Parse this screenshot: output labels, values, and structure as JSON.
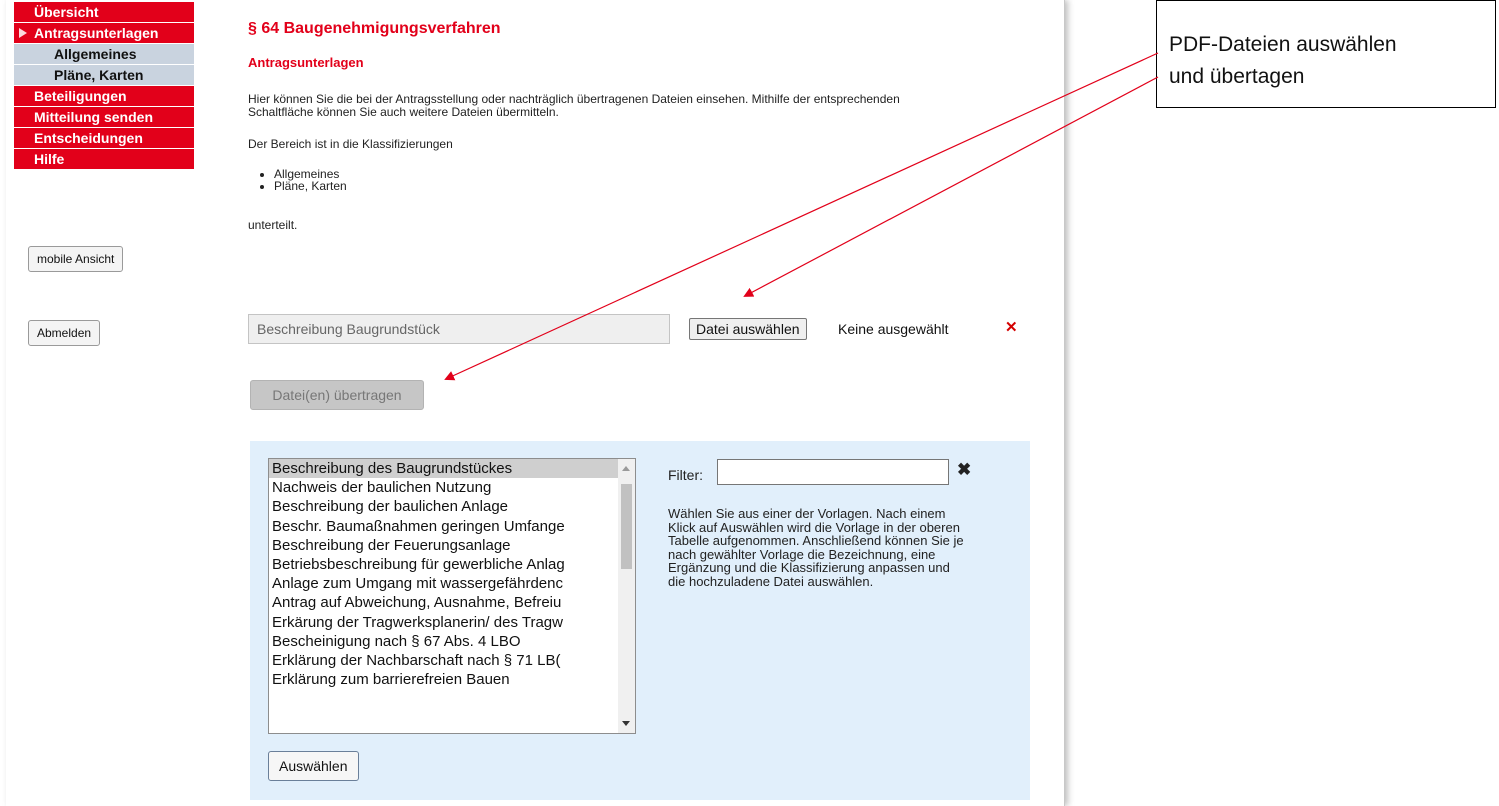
{
  "sidebar": {
    "items": [
      {
        "label": "Übersicht"
      },
      {
        "label": "Antragsunterlagen"
      },
      {
        "label": "Allgemeines"
      },
      {
        "label": "Pläne, Karten"
      },
      {
        "label": "Beteiligungen"
      },
      {
        "label": "Mitteilung senden"
      },
      {
        "label": "Entscheidungen"
      },
      {
        "label": "Hilfe"
      }
    ],
    "mobile_button": "mobile Ansicht",
    "logout_button": "Abmelden"
  },
  "main": {
    "title": "§ 64 Baugenehmigungsverfahren",
    "subtitle": "Antragsunterlagen",
    "intro_line1": "Hier können Sie die bei der Antragsstellung oder nachträglich übertragenen Dateien einsehen. Mithilfe der entsprechenden",
    "intro_line2": "Schaltfläche können Sie auch weitere Dateien übermitteln.",
    "classification_intro": "Der Bereich ist in die Klassifizierungen",
    "classifications": [
      "Allgemeines",
      "Pläne, Karten"
    ],
    "classification_outro": "unterteilt.",
    "upload": {
      "description_value": "Beschreibung Baugrundstück",
      "file_button": "Datei auswählen",
      "file_status": "Keine ausgewählt",
      "remove_icon": "x-icon",
      "transfer_button": "Datei(en) übertragen"
    },
    "templates": {
      "items": [
        "Beschreibung des Baugrundstückes",
        "Nachweis der baulichen Nutzung",
        "Beschreibung der baulichen Anlage",
        "Beschr. Baumaßnahmen geringen Umfange",
        "Beschreibung der Feuerungsanlage",
        "Betriebsbeschreibung für gewerbliche Anlag",
        "Anlage zum Umgang mit wassergefährdenc",
        "Antrag auf Abweichung, Ausnahme, Befreiu",
        "Erkärung der Tragwerksplanerin/ des Tragw",
        "Bescheinigung nach § 67 Abs. 4 LBO",
        "Erklärung der Nachbarschaft nach § 71 LB(",
        "Erklärung zum barrierefreien Bauen"
      ],
      "selected_index": 0,
      "select_button": "Auswählen",
      "filter_label": "Filter:",
      "filter_value": "",
      "help_text": "Wählen Sie aus einer der Vorlagen. Nach einem Klick auf Auswählen wird die Vorlage in der oberen Tabelle aufgenommen. Anschließend können Sie je nach gewählter Vorlage die Bezeichnung, eine Ergänzung und die Klassifizierung anpassen und die hochzuladene Datei auswählen."
    }
  },
  "annotation": {
    "line1": "PDF-Dateien auswählen",
    "line2": "und übertagen"
  },
  "colors": {
    "nav_red": "#e2001a",
    "nav_sub": "#c9d3df",
    "panel_blue": "#e1effb",
    "arrow_red": "#e2001a"
  }
}
